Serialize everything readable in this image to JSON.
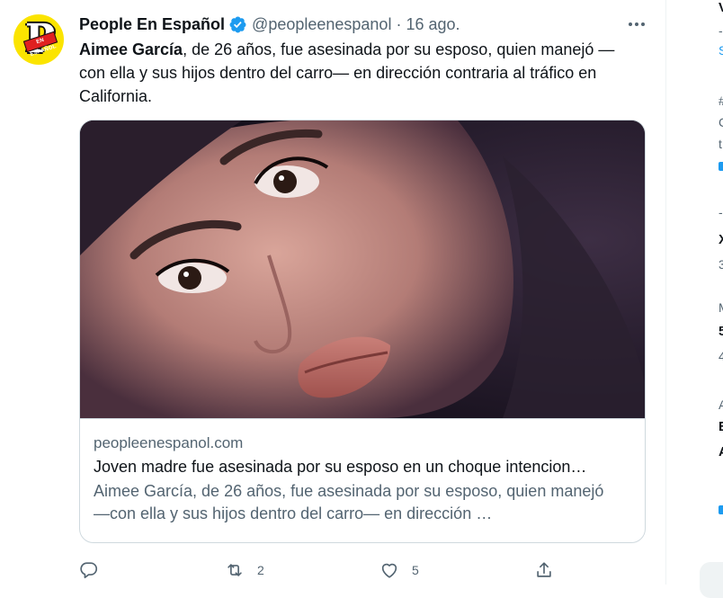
{
  "tweet": {
    "author_name": "People En Español",
    "handle": "@peopleenespanol",
    "separator": "·",
    "date": "16 ago.",
    "avatar_letter": "P",
    "avatar_ribbon": "EN ESPAÑOL",
    "text_bold": "Aimee García",
    "text_rest": ", de 26 años, fue asesinada por su esposo, quien manejó —con ella y sus hijos dentro del carro— en dirección contraria al tráfico en California.",
    "icons": {
      "verified": "verified-badge-icon",
      "more": "more-options-icon"
    }
  },
  "card": {
    "image_alt": "Photo of a young woman",
    "domain": "peopleenespanol.com",
    "title": "Joven madre fue asesinada por su esposo en un choque intencion…",
    "description": "Aimee García, de 26 años, fue asesinada por su esposo, quien manejó —con ella y sus hijos dentro del carro— en dirección …"
  },
  "actions": {
    "reply": {
      "icon": "reply-icon",
      "count": ""
    },
    "retweet": {
      "icon": "retweet-icon",
      "count": "2"
    },
    "like": {
      "icon": "heart-icon",
      "count": "5"
    },
    "share": {
      "icon": "share-icon",
      "count": ""
    }
  },
  "sidebar_fragments": {
    "f1": "V",
    "f2": "-",
    "f3": "S",
    "f4": "#",
    "f5": "C",
    "f6": "t",
    "f7": "-",
    "f8": "X",
    "f9": "3",
    "f10": "M",
    "f11": "5",
    "f12": "4",
    "f13": "A",
    "f14": "E",
    "f15": "A"
  },
  "colors": {
    "accent": "#1d9bf0",
    "text": "#0f1419",
    "secondary": "#536471",
    "border": "#cfd9de",
    "avatar_bg": "#fbe400"
  }
}
